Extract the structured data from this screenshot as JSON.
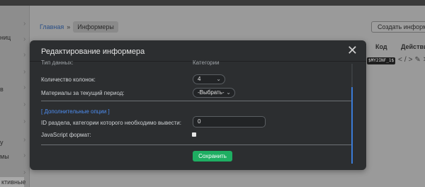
{
  "background": {
    "left_rail_fragments": [
      "ниц",
      "в",
      "у",
      "мы"
    ],
    "left_rail_bottom": "ктивные",
    "breadcrumbs": {
      "home": "Главная",
      "separator": "»",
      "current": "Информеры"
    },
    "create_button": "Создать информер",
    "table": {
      "headers": {
        "code": "Код",
        "actions": "Действия"
      },
      "row_code": "$MY2INF_1$"
    }
  },
  "modal": {
    "title": "Редактирование информера",
    "close_icon": "close-icon",
    "cut_off_label": "Тип данных:",
    "cut_off_value": "Категории",
    "columns_label": "Количество колонок:",
    "columns_value": "4",
    "period_label": "Материалы за текущий период:",
    "period_value": "-Выбрать-",
    "extra_options_link": "[ Дополнительные опции ]",
    "section_id_label": "ID раздела, категории которого необходимо вывести:",
    "section_id_value": "0",
    "js_format_label": "JavaScript формат:",
    "js_format_checked": false,
    "save_button": "Сохранить",
    "accent_color": "#1eae62",
    "link_color": "#4d8df0"
  }
}
